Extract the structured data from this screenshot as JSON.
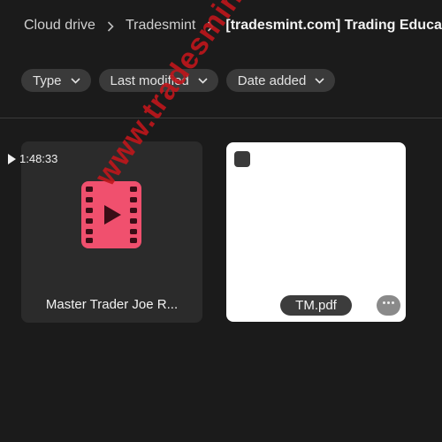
{
  "breadcrumb": {
    "items": [
      "Cloud drive",
      "Tradesmint",
      "[tradesmint.com] Trading Educat"
    ]
  },
  "filters": [
    {
      "label": "Type"
    },
    {
      "label": "Last modified"
    },
    {
      "label": "Date added"
    }
  ],
  "files": [
    {
      "name": "Master Trader Joe R...",
      "duration": "1:48:33",
      "kind": "video",
      "icon": "video-file-icon",
      "icon_color": "#f0506e"
    },
    {
      "name": "TM.pdf",
      "kind": "pdf"
    }
  ],
  "watermark": "www.tradesmint.com",
  "colors": {
    "background": "#1b1b1b",
    "chip": "#3a3a3a",
    "card": "#2b2b2b",
    "video_icon": "#f0506e",
    "watermark": "#c0161b"
  }
}
